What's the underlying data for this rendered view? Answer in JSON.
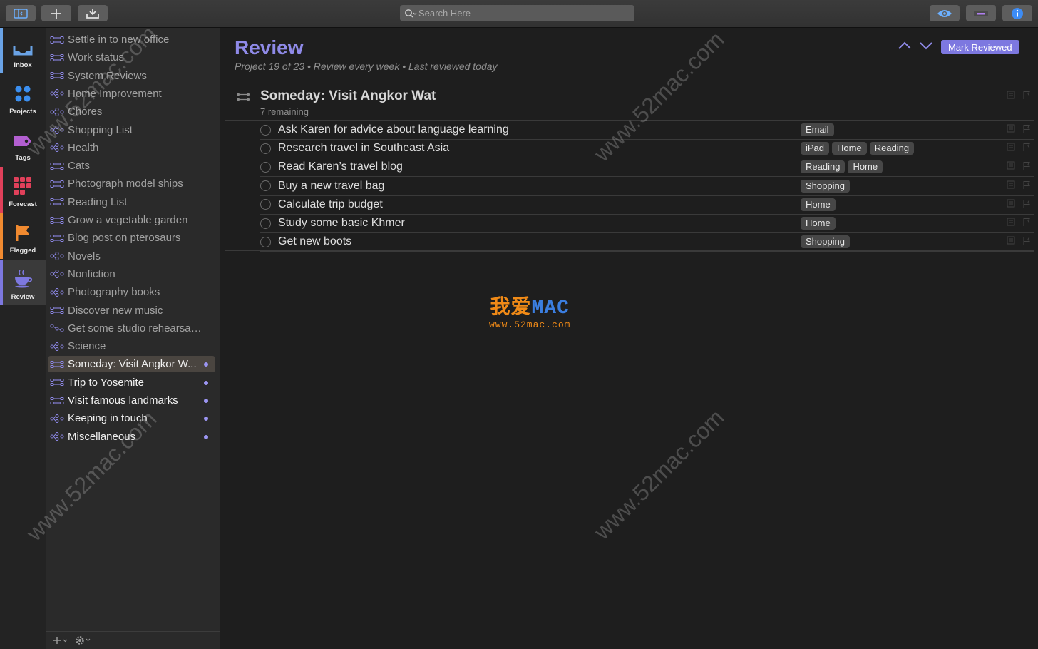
{
  "toolbar": {
    "search_placeholder": "Search Here"
  },
  "perspectives": [
    {
      "label": "Inbox",
      "icon": "inbox-icon",
      "color": "#6aa3e6"
    },
    {
      "label": "Projects",
      "icon": "projects-icon",
      "color": "#3b8ff0"
    },
    {
      "label": "Tags",
      "icon": "tags-icon",
      "color": "#b35fd1"
    },
    {
      "label": "Forecast",
      "icon": "forecast-icon",
      "color": "#e0405a"
    },
    {
      "label": "Flagged",
      "icon": "flag-icon",
      "color": "#f08a30"
    },
    {
      "label": "Review",
      "icon": "coffee-icon",
      "color": "#7d78e0"
    }
  ],
  "sidebar": {
    "items": [
      {
        "label": "Settle in to new office",
        "icon": "sequential"
      },
      {
        "label": "Work status",
        "icon": "sequential"
      },
      {
        "label": "System Reviews",
        "icon": "sequential"
      },
      {
        "label": "Home Improvement",
        "icon": "parallel"
      },
      {
        "label": "Chores",
        "icon": "parallel"
      },
      {
        "label": "Shopping List",
        "icon": "parallel"
      },
      {
        "label": "Health",
        "icon": "parallel"
      },
      {
        "label": "Cats",
        "icon": "sequential"
      },
      {
        "label": "Photograph model ships",
        "icon": "sequential"
      },
      {
        "label": "Reading List",
        "icon": "sequential"
      },
      {
        "label": "Grow a vegetable garden",
        "icon": "sequential"
      },
      {
        "label": "Blog post on pterosaurs",
        "icon": "sequential"
      },
      {
        "label": "Novels",
        "icon": "parallel"
      },
      {
        "label": "Nonfiction",
        "icon": "parallel"
      },
      {
        "label": "Photography books",
        "icon": "parallel"
      },
      {
        "label": "Discover new music",
        "icon": "sequential"
      },
      {
        "label": "Get some studio rehearsal ti...",
        "icon": "single"
      },
      {
        "label": "Science",
        "icon": "parallel"
      },
      {
        "label": "Someday: Visit Angkor W...",
        "icon": "sequential"
      },
      {
        "label": "Trip to Yosemite",
        "icon": "sequential"
      },
      {
        "label": "Visit famous landmarks",
        "icon": "sequential"
      },
      {
        "label": "Keeping in touch",
        "icon": "parallel"
      },
      {
        "label": "Miscellaneous",
        "icon": "parallel"
      }
    ]
  },
  "review": {
    "title": "Review",
    "subtitle": "Project 19 of 23 • Review every week • Last reviewed today",
    "mark_reviewed": "Mark Reviewed"
  },
  "project": {
    "title": "Someday: Visit Angkor Wat",
    "remaining": "7 remaining",
    "tasks": [
      {
        "name": "Ask Karen for advice about language learning",
        "tags": [
          "Email"
        ]
      },
      {
        "name": "Research travel in Southeast Asia",
        "tags": [
          "iPad",
          "Home",
          "Reading"
        ]
      },
      {
        "name": "Read Karen’s travel blog",
        "tags": [
          "Reading",
          "Home"
        ]
      },
      {
        "name": "Buy a new travel bag",
        "tags": [
          "Shopping"
        ]
      },
      {
        "name": "Calculate trip budget",
        "tags": [
          "Home"
        ]
      },
      {
        "name": "Study some basic Khmer",
        "tags": [
          "Home"
        ]
      },
      {
        "name": "Get new boots",
        "tags": [
          "Shopping"
        ]
      }
    ]
  },
  "watermark": {
    "text": "www.52mac.com",
    "logo_cn": "我爱",
    "logo_en": "MAC",
    "logo_url": "www.52mac.com"
  }
}
